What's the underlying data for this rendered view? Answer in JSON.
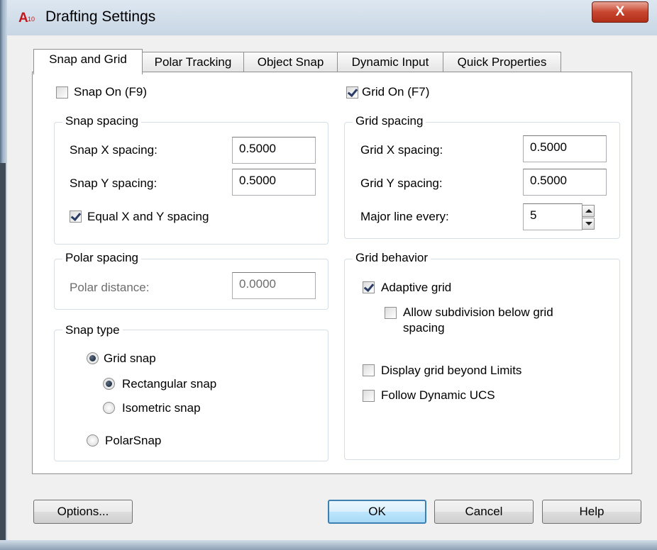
{
  "window": {
    "title": "Drafting Settings",
    "app_icon_text": "A10",
    "close_label": "X"
  },
  "tabs": [
    {
      "label": "Snap and Grid"
    },
    {
      "label": "Polar Tracking"
    },
    {
      "label": "Object Snap"
    },
    {
      "label": "Dynamic Input"
    },
    {
      "label": "Quick Properties"
    }
  ],
  "snap": {
    "on_label": "Snap On (F9)",
    "on_checked": false,
    "spacing_group": "Snap spacing",
    "x_label": "Snap X spacing:",
    "x_value": "0.5000",
    "y_label": "Snap Y spacing:",
    "y_value": "0.5000",
    "equal_label": "Equal X and Y spacing",
    "equal_checked": true
  },
  "polar": {
    "group": "Polar spacing",
    "distance_label": "Polar distance:",
    "distance_value": "0.0000"
  },
  "snap_type": {
    "group": "Snap type",
    "grid_snap": "Grid snap",
    "rectangular": "Rectangular snap",
    "isometric": "Isometric snap",
    "polarsnap": "PolarSnap",
    "selected": [
      "Grid snap",
      "Rectangular snap"
    ]
  },
  "grid": {
    "on_label": "Grid On (F7)",
    "on_checked": true,
    "spacing_group": "Grid spacing",
    "x_label": "Grid X spacing:",
    "x_value": "0.5000",
    "y_label": "Grid Y spacing:",
    "y_value": "0.5000",
    "major_label": "Major line every:",
    "major_value": "5"
  },
  "grid_behavior": {
    "group": "Grid behavior",
    "adaptive": "Adaptive grid",
    "adaptive_checked": true,
    "subdivision_line1": "Allow subdivision below grid",
    "subdivision_line2": "spacing",
    "subdivision_checked": false,
    "beyond_limits": "Display grid beyond Limits",
    "beyond_checked": false,
    "dynamic_ucs": "Follow Dynamic UCS",
    "dynamic_ucs_checked": false
  },
  "buttons": {
    "options": "Options...",
    "ok": "OK",
    "cancel": "Cancel",
    "help": "Help"
  },
  "colors": {
    "accent": "#3c7fb1",
    "close": "#c8452f",
    "title_bg": "#c8d6e4"
  }
}
